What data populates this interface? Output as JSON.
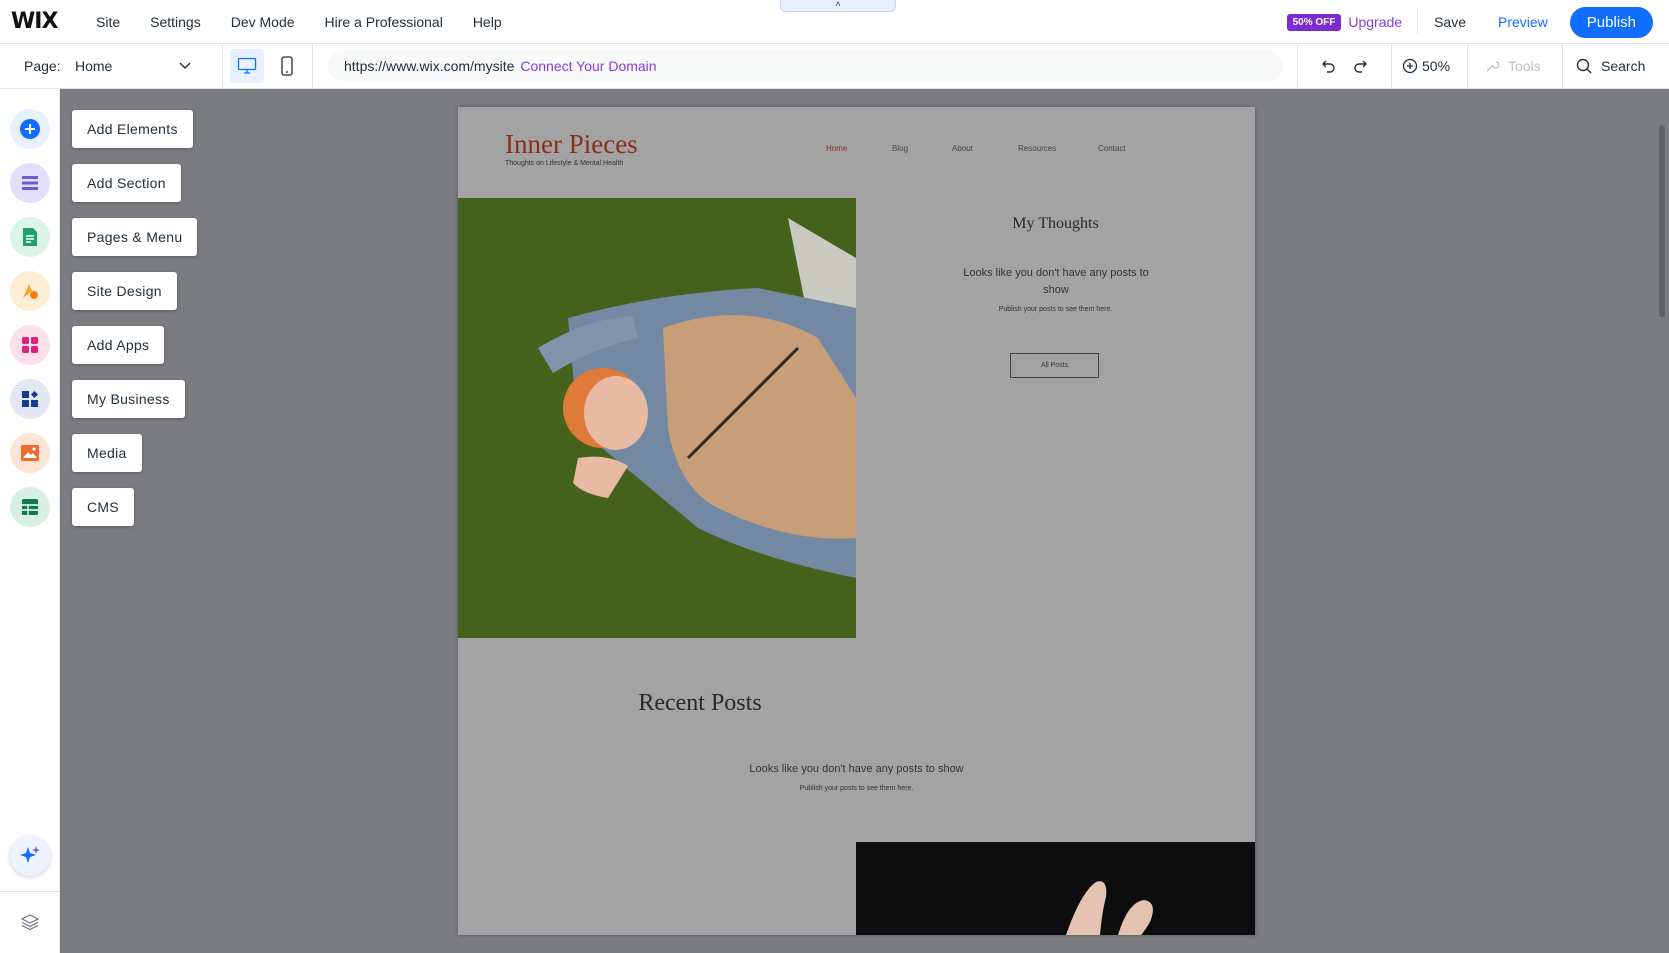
{
  "topbar": {
    "logo": "WIX",
    "menu": [
      "Site",
      "Settings",
      "Dev Mode",
      "Hire a Professional",
      "Help"
    ],
    "collapse_icon": "chevron-up-icon",
    "badge": "50% OFF",
    "upgrade": "Upgrade",
    "save": "Save",
    "preview": "Preview",
    "publish": "Publish"
  },
  "subbar": {
    "page_label": "Page:",
    "page_value": "Home",
    "url": "https://www.wix.com/mysite",
    "connect_domain": "Connect Your Domain",
    "zoom": "50%",
    "tools": "Tools",
    "search": "Search"
  },
  "rail": [
    {
      "icon": "add-elements-icon",
      "color": "#116dff"
    },
    {
      "icon": "add-section-icon",
      "color": "#6b5bd6"
    },
    {
      "icon": "pages-menu-icon",
      "color": "#22a06b"
    },
    {
      "icon": "site-design-icon",
      "color": "#f5a623"
    },
    {
      "icon": "add-apps-icon",
      "color": "#e0237a"
    },
    {
      "icon": "my-business-icon",
      "color": "#1c3a8a"
    },
    {
      "icon": "media-icon",
      "color": "#f06a2b"
    },
    {
      "icon": "cms-icon",
      "color": "#0f7a52"
    },
    {
      "icon": "ai-sparkle-icon",
      "color": "#116dff"
    },
    {
      "icon": "layers-icon",
      "color": "#6b7280"
    }
  ],
  "panel": {
    "add_elements": "Add Elements",
    "add_section": "Add Section",
    "pages_menu": "Pages & Menu",
    "site_design": "Site Design",
    "add_apps": "Add Apps",
    "my_business": "My Business",
    "media": "Media",
    "cms": "CMS"
  },
  "site": {
    "title": "Inner Pieces",
    "tagline": "Thoughts on Lifestyle & Mental Health",
    "nav": [
      "Home",
      "Blog",
      "About",
      "Resources",
      "Contact"
    ],
    "thoughts_title": "My Thoughts",
    "thoughts_empty": "Looks like you don't have any posts to show",
    "thoughts_sub": "Publish your posts to see them here.",
    "all_posts": "All Posts",
    "recent_title": "Recent Posts",
    "recent_empty": "Looks like you don't have any posts to show",
    "recent_sub": "Publish your posts to see them here."
  }
}
